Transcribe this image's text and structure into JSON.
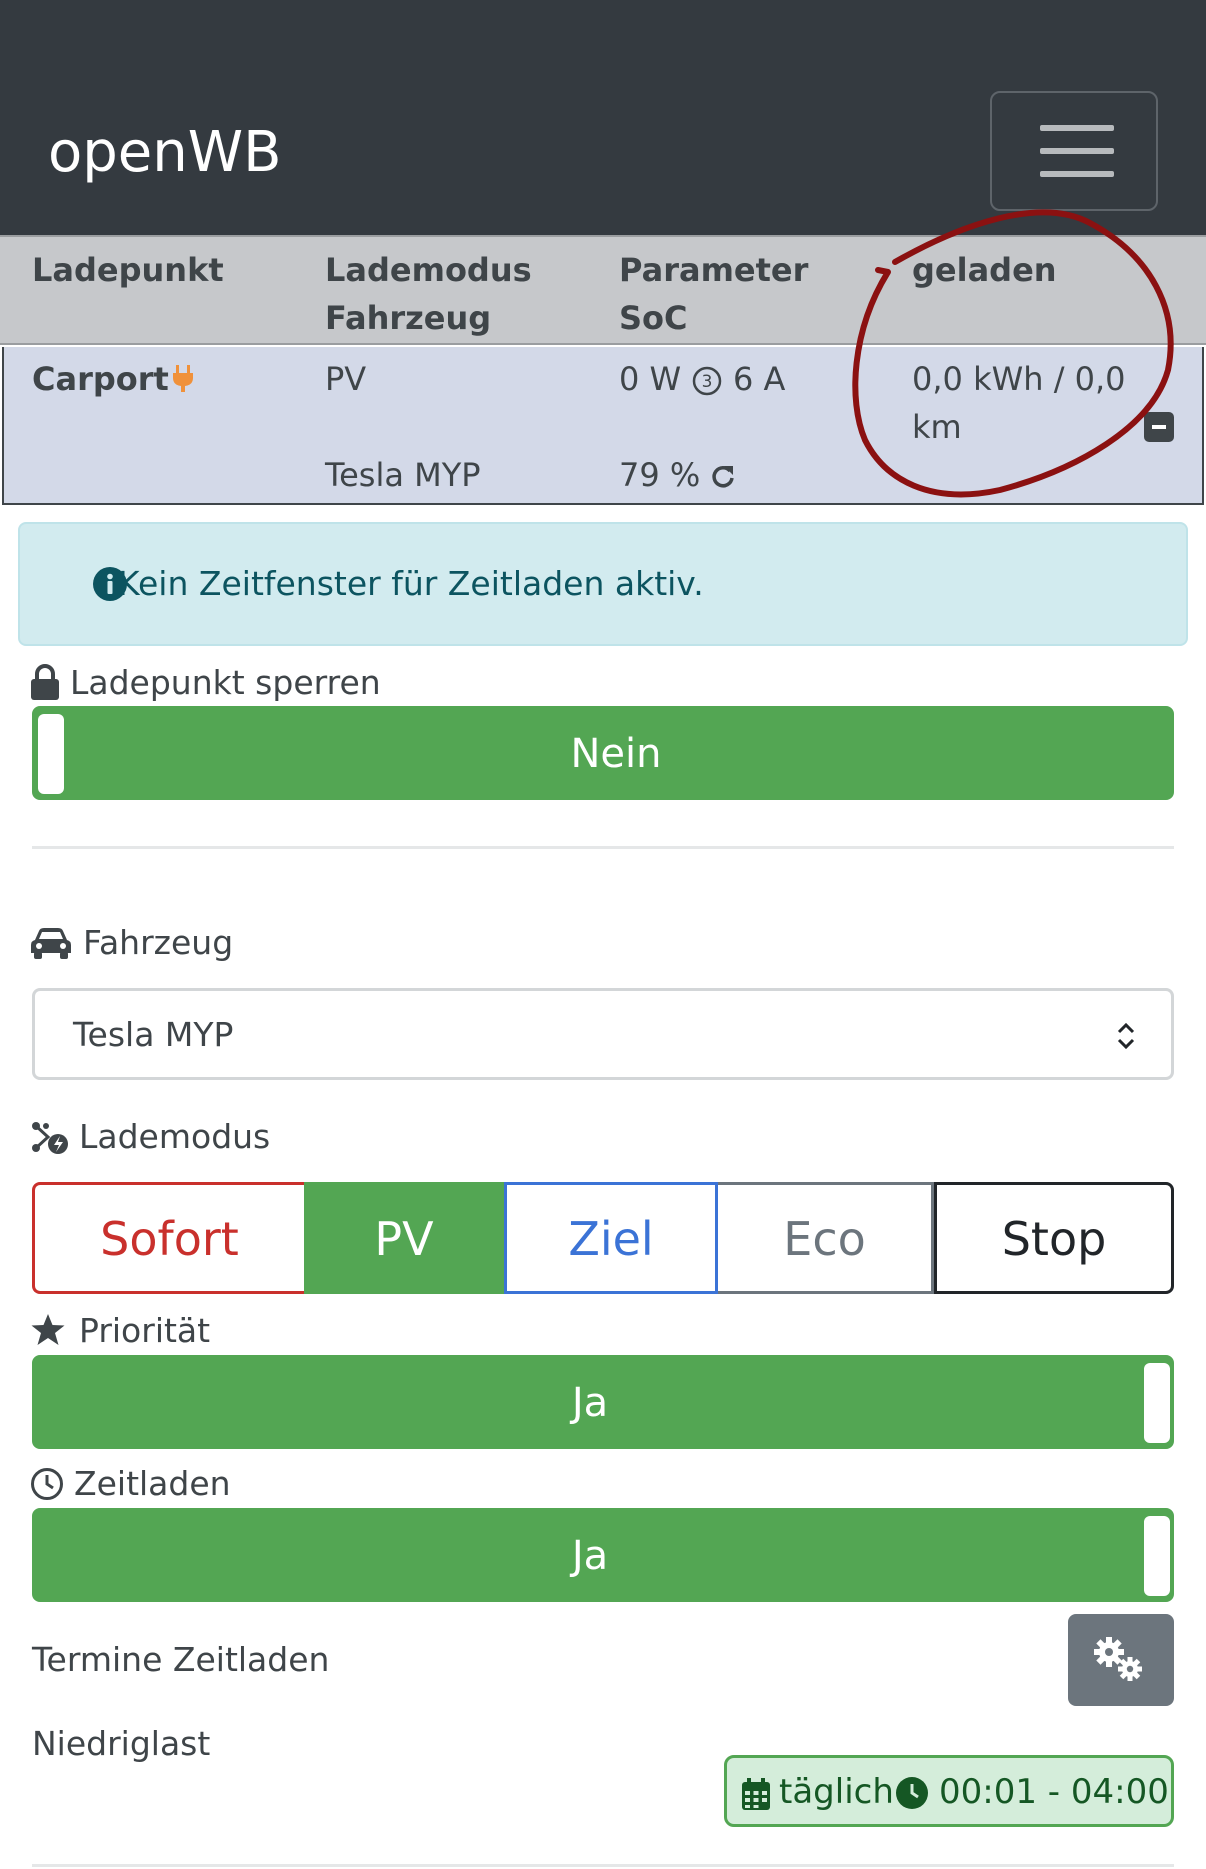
{
  "navbar": {
    "brand": "openWB",
    "menu_icon": "hamburger-menu-icon"
  },
  "table": {
    "headers": [
      {
        "line1": "Ladepunkt",
        "line2": ""
      },
      {
        "line1": "Lademodus",
        "line2": "Fahrzeug"
      },
      {
        "line1": "Parameter",
        "line2": "SoC"
      },
      {
        "line1": "geladen",
        "line2": ""
      }
    ],
    "row": {
      "name": "Carport",
      "plug_icon": "plug-icon",
      "mode": "PV",
      "vehicle": "Tesla MYP",
      "power": "0 W",
      "phases": "3",
      "current": "6 A",
      "soc": "79 %",
      "charged_line1": "0,0 kWh / 0,0",
      "charged_line2": "km"
    }
  },
  "alert": {
    "text": "Kein Zeitfenster für Zeitladen aktiv."
  },
  "lock": {
    "label": "Ladepunkt sperren",
    "value": "Nein"
  },
  "vehicle": {
    "label": "Fahrzeug",
    "selected": "Tesla MYP"
  },
  "charge_mode": {
    "label": "Lademodus",
    "options": [
      "Sofort",
      "PV",
      "Ziel",
      "Eco",
      "Stop"
    ],
    "selected": "PV"
  },
  "priority": {
    "label": "Priorität",
    "value": "Ja"
  },
  "time_charging": {
    "label": "Zeitladen",
    "value": "Ja"
  },
  "schedules": {
    "title": "Termine Zeitladen",
    "plan_name": "Niedriglast",
    "frequency": "täglich",
    "time_range": "00:01 - 04:00"
  },
  "colors": {
    "navbar": "#343a40",
    "success": "#53a653",
    "danger": "#c9302c",
    "primary": "#3b73d6",
    "annotation": "#8b1111"
  }
}
